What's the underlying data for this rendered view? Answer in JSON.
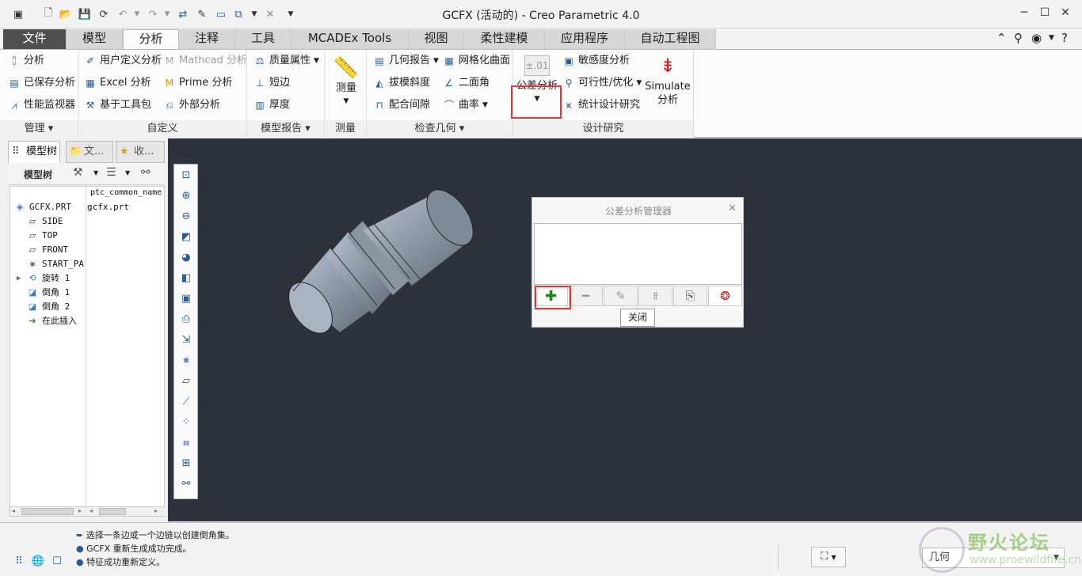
{
  "window": {
    "title": "GCFX (活动的) - Creo Parametric 4.0"
  },
  "tabs": [
    "文件",
    "模型",
    "分析",
    "注释",
    "工具",
    "MCADEx Tools",
    "视图",
    "柔性建模",
    "应用程序",
    "自动工程图"
  ],
  "ribbon": {
    "manage": {
      "items": [
        "分析",
        "已保存分析",
        "性能监视器"
      ],
      "title": "管理"
    },
    "custom": {
      "items": [
        "用户定义分析",
        "Mathcad 分析",
        "Excel 分析",
        "Prime 分析",
        "基于工具包",
        "外部分析"
      ],
      "title": "自定义"
    },
    "model_report": {
      "items": [
        "质量属性",
        "短边",
        "厚度"
      ],
      "title": "模型报告"
    },
    "measure": {
      "label": "测量",
      "title": "测量"
    },
    "inspect_geometry": {
      "items": [
        "几何报告",
        "网格化曲面",
        "拔模斜度",
        "二面角",
        "配合间隙",
        "曲率"
      ],
      "title": "检查几何"
    },
    "design_study": {
      "tolerance_icon_text": "±.01",
      "tolerance_label": "公差分析",
      "items": [
        "敏感度分析",
        "可行性/优化",
        "统计设计研究"
      ],
      "simulate_label_1": "Simulate",
      "simulate_label_2": "分析",
      "title": "设计研究"
    }
  },
  "left_panel": {
    "tabs": [
      "模型树",
      "文...",
      "收..."
    ],
    "toolbar_label": "模型树",
    "column_header": "ptc_common_name",
    "tree": [
      {
        "name": "GCFX.PRT",
        "value": "gcfx.prt",
        "icon": "part-icon"
      },
      {
        "name": "SIDE",
        "icon": "datum-plane-icon"
      },
      {
        "name": "TOP",
        "icon": "datum-plane-icon"
      },
      {
        "name": "FRONT",
        "icon": "datum-plane-icon"
      },
      {
        "name": "START_PA",
        "icon": "coordinate-system-icon"
      },
      {
        "name": "旋转 1",
        "icon": "revolve-icon"
      },
      {
        "name": "倒角 1",
        "icon": "chamfer-icon"
      },
      {
        "name": "倒角 2",
        "icon": "chamfer-icon"
      },
      {
        "name": "在此插入",
        "icon": "insert-here-icon"
      }
    ]
  },
  "dialog": {
    "title": "公差分析管理器",
    "close_label": "关闭"
  },
  "status": {
    "messages": [
      "选择一条边或一个边链以创建倒角集。",
      "GCFX 重新生成成功完成。",
      "特征成功重新定义。"
    ],
    "filter_value": "几何"
  },
  "watermark": {
    "text_cn": "野火论坛",
    "url": "www.proewildfire.cn"
  }
}
